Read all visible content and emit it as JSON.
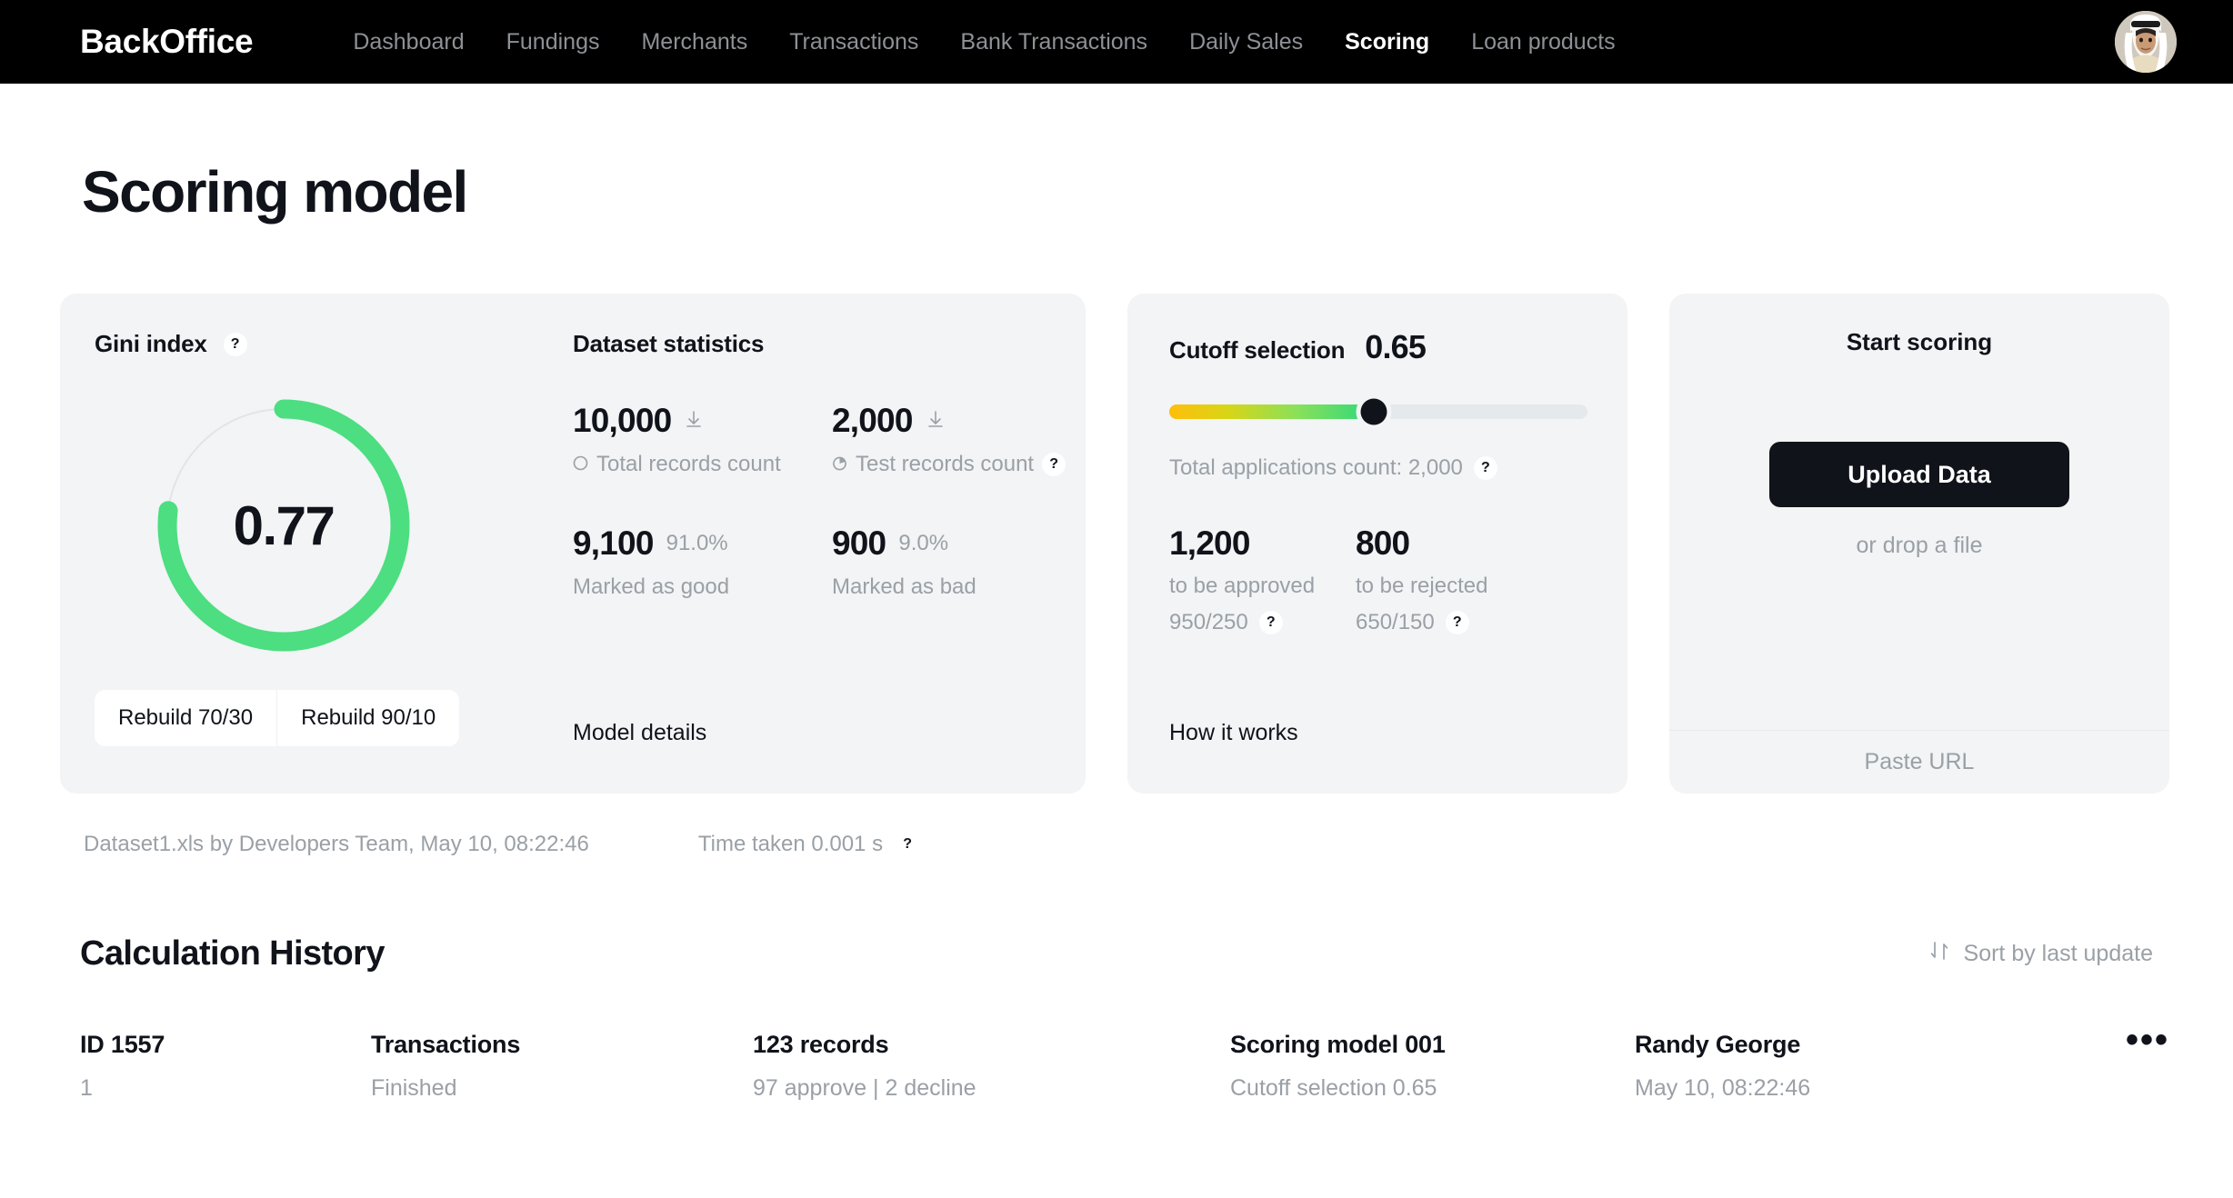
{
  "header": {
    "brand": "BackOffice",
    "nav": [
      {
        "label": "Dashboard",
        "active": false
      },
      {
        "label": "Fundings",
        "active": false
      },
      {
        "label": "Merchants",
        "active": false
      },
      {
        "label": "Transactions",
        "active": false
      },
      {
        "label": "Bank Transactions",
        "active": false
      },
      {
        "label": "Daily Sales",
        "active": false
      },
      {
        "label": "Scoring",
        "active": true
      },
      {
        "label": "Loan products",
        "active": false
      }
    ],
    "avatar_icon": "user-avatar"
  },
  "page": {
    "title": "Scoring model"
  },
  "gini": {
    "title": "Gini index",
    "help": "?",
    "value": "0.77",
    "rebuild_1": "Rebuild 70/30",
    "rebuild_2": "Rebuild 90/10",
    "accent_color": "#4CDE80",
    "track_color": "#e2e5e8"
  },
  "dataset": {
    "title": "Dataset statistics",
    "total_value": "10,000",
    "total_label": "Total records count",
    "total_icon": "circle-icon",
    "test_value": "2,000",
    "test_label": "Test records count",
    "test_icon": "pie-chart-icon",
    "test_help": "?",
    "download_icon": "download-icon",
    "good_value": "9,100",
    "good_pct": "91.0%",
    "good_label": "Marked as good",
    "bad_value": "900",
    "bad_pct": "9.0%",
    "bad_label": "Marked as bad",
    "model_details": "Model details"
  },
  "cutoff": {
    "title": "Cutoff selection",
    "value": "0.65",
    "slider_percent": 49,
    "total_text": "Total applications count: 2,000",
    "total_help": "?",
    "approved_value": "1,200",
    "approved_label": "to be approved",
    "approved_ratio": "950/250",
    "approved_help": "?",
    "rejected_value": "800",
    "rejected_label": "to be rejected",
    "rejected_ratio": "650/150",
    "rejected_help": "?",
    "how_it_works": "How it works"
  },
  "scoring": {
    "title": "Start scoring",
    "upload_label": "Upload Data",
    "drop_hint": "or drop a file",
    "paste_url": "Paste URL"
  },
  "meta": {
    "dataset_info": "Dataset1.xls by Developers Team, May 10, 08:22:46",
    "time_taken": "Time taken 0.001 s",
    "time_help": "?"
  },
  "history": {
    "title": "Calculation History",
    "sort_label": "Sort by last update",
    "sort_icon": "sort-arrows-icon",
    "menu_icon": "kebab-menu-icon",
    "rows": [
      {
        "id_main": "ID 1557",
        "id_sub": "1",
        "type_main": "Transactions",
        "type_sub": "Finished",
        "records_main": "123 records",
        "records_sub": "97 approve | 2 decline",
        "model_main": "Scoring model 001",
        "model_sub": "Cutoff selection 0.65",
        "user_main": "Randy George",
        "user_sub": "May 10, 08:22:46",
        "menu": "•••"
      }
    ]
  }
}
